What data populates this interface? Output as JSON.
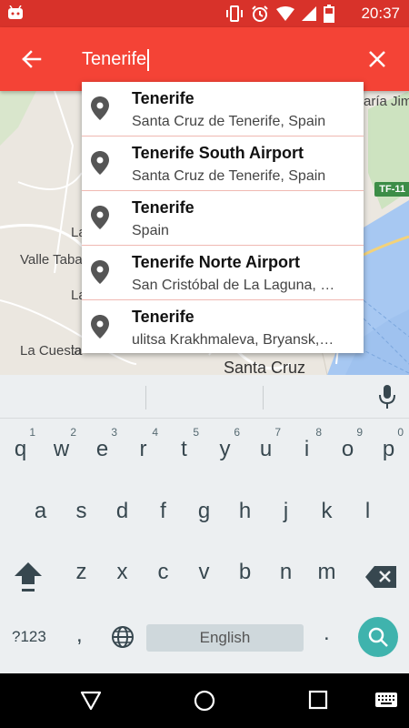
{
  "status_bar": {
    "time": "20:37"
  },
  "search_bar": {
    "query": "Tenerife"
  },
  "map": {
    "labels": [
      "aría Jim",
      "Valle Taba",
      "La Cuesta",
      "Santa Cruz",
      "La",
      "La",
      "la"
    ],
    "road_badge": "TF-11"
  },
  "suggestions": [
    {
      "title": "Tenerife",
      "subtitle": "Santa Cruz de Tenerife, Spain"
    },
    {
      "title": "Tenerife South Airport",
      "subtitle": "Santa Cruz de Tenerife, Spain"
    },
    {
      "title": "Tenerife",
      "subtitle": "Spain"
    },
    {
      "title": "Tenerife Norte Airport",
      "subtitle": "San Cristóbal de La Laguna, …"
    },
    {
      "title": "Tenerife",
      "subtitle": "ulitsa Krakhmaleva, Bryansk,…"
    }
  ],
  "keyboard": {
    "row1": [
      {
        "ch": "q",
        "num": "1"
      },
      {
        "ch": "w",
        "num": "2"
      },
      {
        "ch": "e",
        "num": "3"
      },
      {
        "ch": "r",
        "num": "4"
      },
      {
        "ch": "t",
        "num": "5"
      },
      {
        "ch": "y",
        "num": "6"
      },
      {
        "ch": "u",
        "num": "7"
      },
      {
        "ch": "i",
        "num": "8"
      },
      {
        "ch": "o",
        "num": "9"
      },
      {
        "ch": "p",
        "num": "0"
      }
    ],
    "row2": [
      "a",
      "s",
      "d",
      "f",
      "g",
      "h",
      "j",
      "k",
      "l"
    ],
    "row3": [
      "z",
      "x",
      "c",
      "v",
      "b",
      "n",
      "m"
    ],
    "symbols_key": "?123",
    "comma_key": ",",
    "space_label": "English",
    "period_key": "."
  },
  "colors": {
    "status_bar": "#d8322a",
    "app_bar": "#f44336",
    "suggestion_divider": "#f0b9b2",
    "search_key": "#3fb3ad",
    "map_water": "#a7c8f2"
  }
}
